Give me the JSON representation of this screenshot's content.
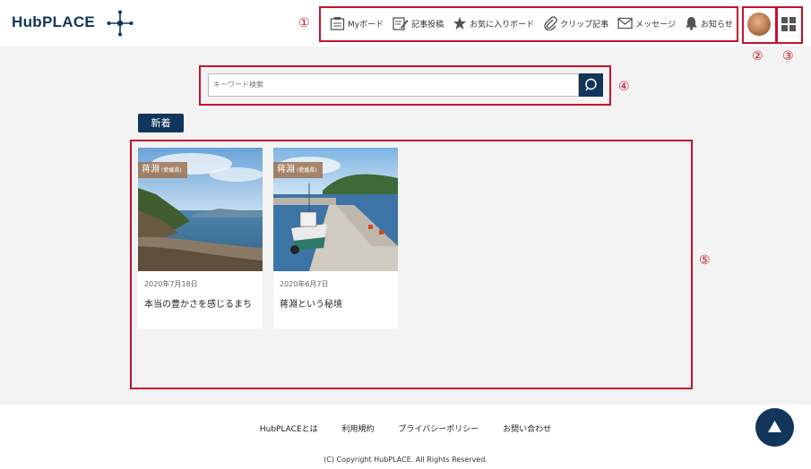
{
  "header": {
    "logo_text": "HubPLACE",
    "nav": [
      {
        "label": "Myボード",
        "icon": "board-icon"
      },
      {
        "label": "記事投稿",
        "icon": "edit-icon"
      },
      {
        "label": "お気に入りボード",
        "icon": "star-icon"
      },
      {
        "label": "クリップ記事",
        "icon": "paperclip-icon"
      },
      {
        "label": "メッセージ",
        "icon": "envelope-icon"
      },
      {
        "label": "お知らせ",
        "icon": "bell-icon"
      }
    ]
  },
  "callouts": [
    "①",
    "②",
    "③",
    "④",
    "⑤"
  ],
  "search": {
    "placeholder": "キーワード検索"
  },
  "section_label": "新着",
  "cards": [
    {
      "tag": "蒋淵",
      "tag_sub": "(愛媛県)",
      "date": "2020年7月18日",
      "title": "本当の豊かさを感じるまち"
    },
    {
      "tag": "蒋淵",
      "tag_sub": "(愛媛県)",
      "date": "2020年6月7日",
      "title": "蒋淵という秘境"
    }
  ],
  "footer": {
    "links": [
      "HubPLACEとは",
      "利用規約",
      "プライバシーポリシー",
      "お問い合わせ"
    ],
    "copyright": "(C) Copyright HubPLACE. All Rights Reserved."
  },
  "colors": {
    "brand": "#12355b",
    "callout": "#c8102e",
    "background": "#f3f3f3"
  }
}
